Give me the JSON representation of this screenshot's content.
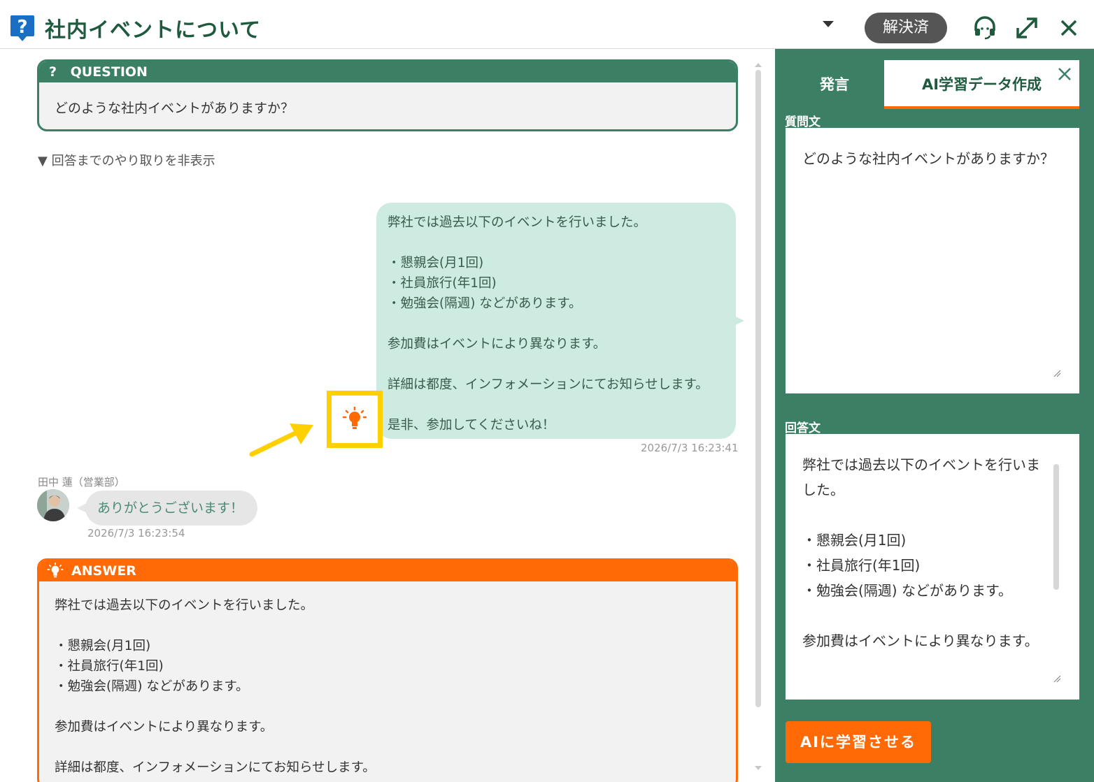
{
  "header": {
    "title": "社内イベントについて",
    "status_badge": "解決済"
  },
  "question": {
    "heading": "QUESTION",
    "heading_icon": "?",
    "text": "どのような社内イベントがありますか？"
  },
  "thread": {
    "toggle_label": "▼ 回答までのやり取りを非表示",
    "staff_message": {
      "text": "弊社では過去以下のイベントを行いました。\n\n・懇親会(月1回)\n・社員旅行(年1回)\n・勉強会(隔週) などがあります。\n\n参加費はイベントにより異なります。\n\n詳細は都度、インフォメーションにてお知らせします。\n\n是非、参加してくださいね！",
      "timestamp": "2026/7/3 16:23:41"
    },
    "user_message": {
      "sender": "田中 蓮（営業部）",
      "text": "ありがとうございます！",
      "timestamp": "2026/7/3 16:23:54"
    }
  },
  "answer": {
    "heading": "ANSWER",
    "text": "弊社では過去以下のイベントを行いました。\n\n・懇親会(月1回)\n・社員旅行(年1回)\n・勉強会(隔週) などがあります。\n\n参加費はイベントにより異なります。\n\n詳細は都度、インフォメーションにてお知らせします。"
  },
  "side_panel": {
    "tabs": [
      {
        "label": "発言",
        "active": false
      },
      {
        "label": "AI学習データ作成",
        "active": true
      }
    ],
    "question_label": "質問文",
    "question_value": "どのような社内イベントがありますか？",
    "answer_label": "回答文",
    "answer_value": "弊社では過去以下のイベントを行いました。\n\n・懇親会(月1回)\n・社員旅行(年1回)\n・勉強会(隔週) などがあります。\n\n参加費はイベントにより異なります。",
    "submit_label": "AIに学習させる"
  },
  "colors": {
    "brand_green": "#3b7f64",
    "title_green": "#1f5a3f",
    "accent_orange": "#ff6a07",
    "highlight_yellow": "#ffd000",
    "staff_bubble": "#cdebe0",
    "user_bubble": "#e6e6e6",
    "badge_gray": "#555555"
  },
  "icons": [
    "question-mark-icon",
    "chevron-down-icon",
    "headset-icon",
    "expand-icon",
    "close-icon",
    "lightbulb-icon",
    "arrow-icon",
    "avatar-photo"
  ]
}
